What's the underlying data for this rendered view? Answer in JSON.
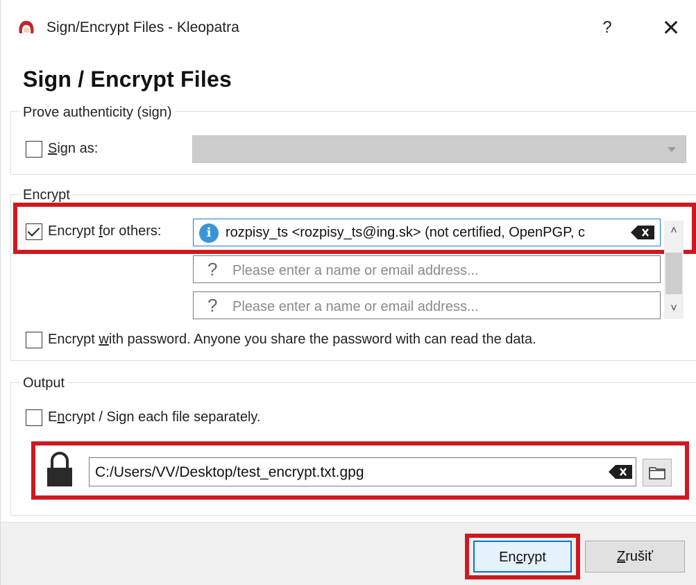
{
  "window": {
    "title": "Sign/Encrypt Files - Kleopatra",
    "help_label": "?",
    "close_label": "✕"
  },
  "heading": "Sign / Encrypt Files",
  "sign_group": {
    "title": "Prove authenticity (sign)",
    "sign_as_label_prefix": "S",
    "sign_as_label_rest": "ign as:",
    "sign_as_checked": false,
    "sign_as_value": ""
  },
  "encrypt_group": {
    "title": "Encrypt",
    "encrypt_for_others_pre": "Encrypt ",
    "encrypt_for_others_ul": "f",
    "encrypt_for_others_post": "or others:",
    "encrypt_for_others_checked": true,
    "recipients": [
      {
        "text": "rozpisy_ts <rozpisy_ts@ing.sk> (not certified, OpenPGP, c",
        "status_icon": "info-icon"
      },
      {
        "placeholder": "Please enter a name or email address...",
        "status_icon": "question-icon"
      },
      {
        "placeholder": "Please enter a name or email address...",
        "status_icon": "question-icon"
      }
    ],
    "question_glyph": "?",
    "info_glyph": "i",
    "encrypt_password_pre": "Encrypt ",
    "encrypt_password_ul": "w",
    "encrypt_password_post": "ith password. Anyone you share the password with can read the data.",
    "encrypt_password_checked": false
  },
  "output_group": {
    "title": "Output",
    "separately_pre": "E",
    "separately_ul": "n",
    "separately_post": "crypt / Sign each file separately.",
    "separately_checked": false,
    "output_path": "C:/Users/VV/Desktop/test_encrypt.txt.gpg"
  },
  "buttons": {
    "encrypt_pre": "En",
    "encrypt_ul": "c",
    "encrypt_post": "rypt",
    "cancel_ul": "Z",
    "cancel_post": "rušiť"
  },
  "colors": {
    "highlight_red": "#d0191f",
    "focus_blue": "#1a7ad4",
    "info_blue": "#3a95d8",
    "disabled_combo": "#cccccc"
  }
}
